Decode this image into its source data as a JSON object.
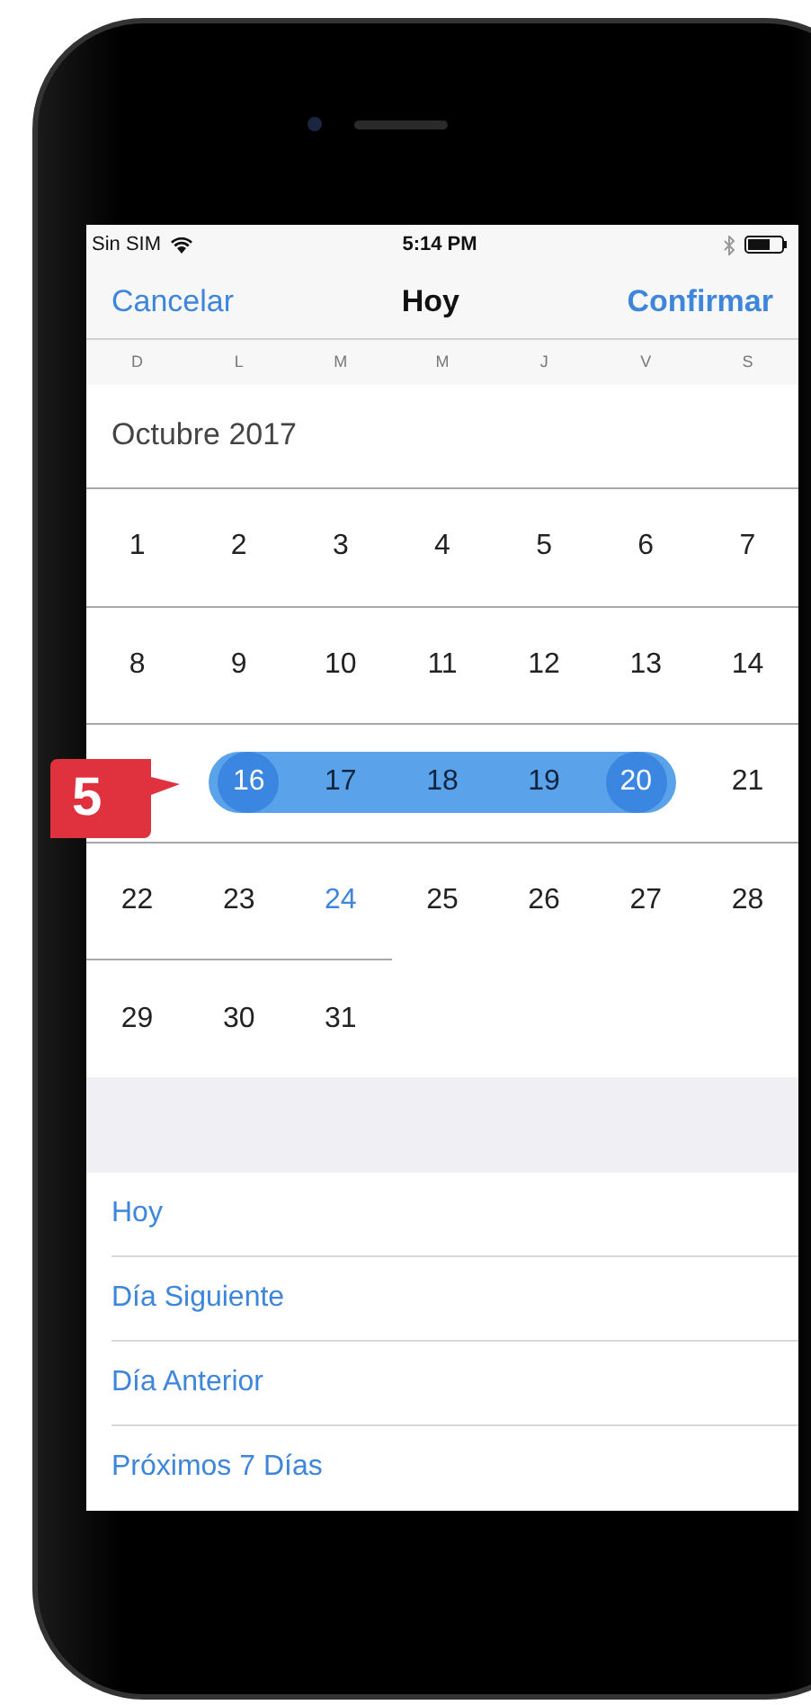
{
  "status_bar": {
    "carrier": "Sin SIM",
    "time": "5:14 PM"
  },
  "nav": {
    "cancel": "Cancelar",
    "title": "Hoy",
    "confirm": "Confirmar"
  },
  "weekdays": [
    "D",
    "L",
    "M",
    "M",
    "J",
    "V",
    "S"
  ],
  "month": "Octubre 2017",
  "weeks": [
    {
      "days": [
        {
          "label": "1",
          "selected": false,
          "today": false
        },
        {
          "label": "2",
          "selected": false,
          "today": false
        },
        {
          "label": "3",
          "selected": false,
          "today": false
        },
        {
          "label": "4",
          "selected": false,
          "today": false
        },
        {
          "label": "5",
          "selected": false,
          "today": false
        },
        {
          "label": "6",
          "selected": false,
          "today": false
        },
        {
          "label": "7",
          "selected": false,
          "today": false
        }
      ]
    },
    {
      "days": [
        {
          "label": "8",
          "selected": false,
          "today": false
        },
        {
          "label": "9",
          "selected": false,
          "today": false
        },
        {
          "label": "10",
          "selected": false,
          "today": false
        },
        {
          "label": "11",
          "selected": false,
          "today": false
        },
        {
          "label": "12",
          "selected": false,
          "today": false
        },
        {
          "label": "13",
          "selected": false,
          "today": false
        },
        {
          "label": "14",
          "selected": false,
          "today": false
        }
      ]
    },
    {
      "first_cell_covered": true,
      "days": [
        {
          "label": "16",
          "selected": true,
          "today": false
        },
        {
          "label": "17",
          "selected": true,
          "today": false
        },
        {
          "label": "18",
          "selected": true,
          "today": false
        },
        {
          "label": "19",
          "selected": true,
          "today": false
        },
        {
          "label": "20",
          "selected": true,
          "today": false
        },
        {
          "label": "21",
          "selected": false,
          "today": false
        }
      ]
    },
    {
      "days": [
        {
          "label": "22",
          "selected": false,
          "today": false
        },
        {
          "label": "23",
          "selected": false,
          "today": false
        },
        {
          "label": "24",
          "selected": false,
          "today": true
        },
        {
          "label": "25",
          "selected": false,
          "today": false
        },
        {
          "label": "26",
          "selected": false,
          "today": false
        },
        {
          "label": "27",
          "selected": false,
          "today": false
        },
        {
          "label": "28",
          "selected": false,
          "today": false
        }
      ]
    },
    {
      "days": [
        {
          "label": "29",
          "selected": false,
          "today": false
        },
        {
          "label": "30",
          "selected": false,
          "today": false
        },
        {
          "label": "31",
          "selected": false,
          "today": false
        }
      ]
    }
  ],
  "shortcuts": [
    "Hoy",
    "Día Siguiente",
    "Día Anterior",
    "Próximos 7 Días"
  ],
  "callout": {
    "label": "5"
  }
}
